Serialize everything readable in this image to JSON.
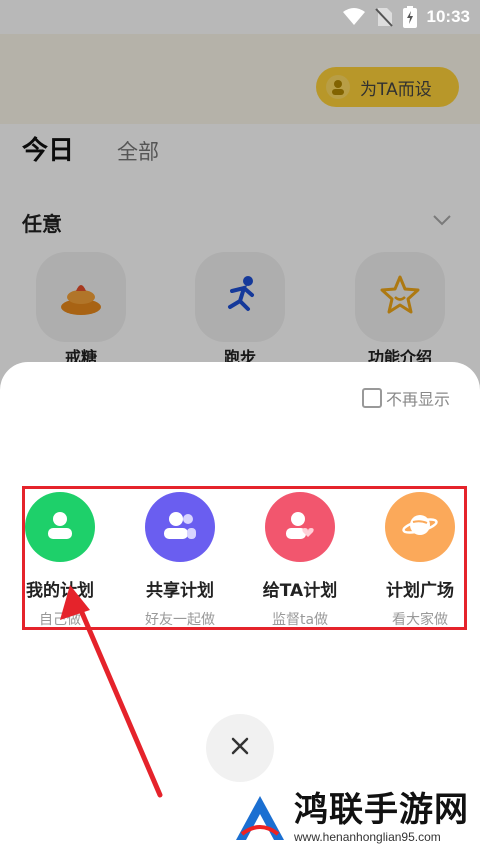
{
  "status_bar": {
    "time": "10:33",
    "icons": [
      "wifi-icon",
      "no-sim-icon",
      "battery-charging-icon"
    ]
  },
  "background": {
    "for_ta_button": "为TA而设",
    "tabs": [
      "今日",
      "全部"
    ],
    "section_title": "任意",
    "quick_items": [
      {
        "label": "戒糖",
        "icon": "cake-icon"
      },
      {
        "label": "跑步",
        "icon": "runner-icon"
      },
      {
        "label": "功能介绍",
        "icon": "star-icon"
      }
    ]
  },
  "sheet": {
    "no_show_label": "不再显示",
    "options": [
      {
        "title": "我的计划",
        "subtitle": "自己做",
        "color": "#1ed06a",
        "icon": "person-icon"
      },
      {
        "title": "共享计划",
        "subtitle": "好友一起做",
        "color": "#6a5ef0",
        "icon": "group-icon"
      },
      {
        "title": "给TA计划",
        "subtitle": "监督ta做",
        "color": "#f2566e",
        "icon": "person-heart-icon"
      },
      {
        "title": "计划广场",
        "subtitle": "看大家做",
        "color": "#fba95a",
        "icon": "planet-icon"
      }
    ],
    "close_icon": "close-icon"
  },
  "colors": {
    "highlight": "#e5232b",
    "accent_yellow": "#ffd23a"
  },
  "watermark": {
    "title": "鸿联手游网",
    "url": "www.henanhonglian95.com"
  }
}
